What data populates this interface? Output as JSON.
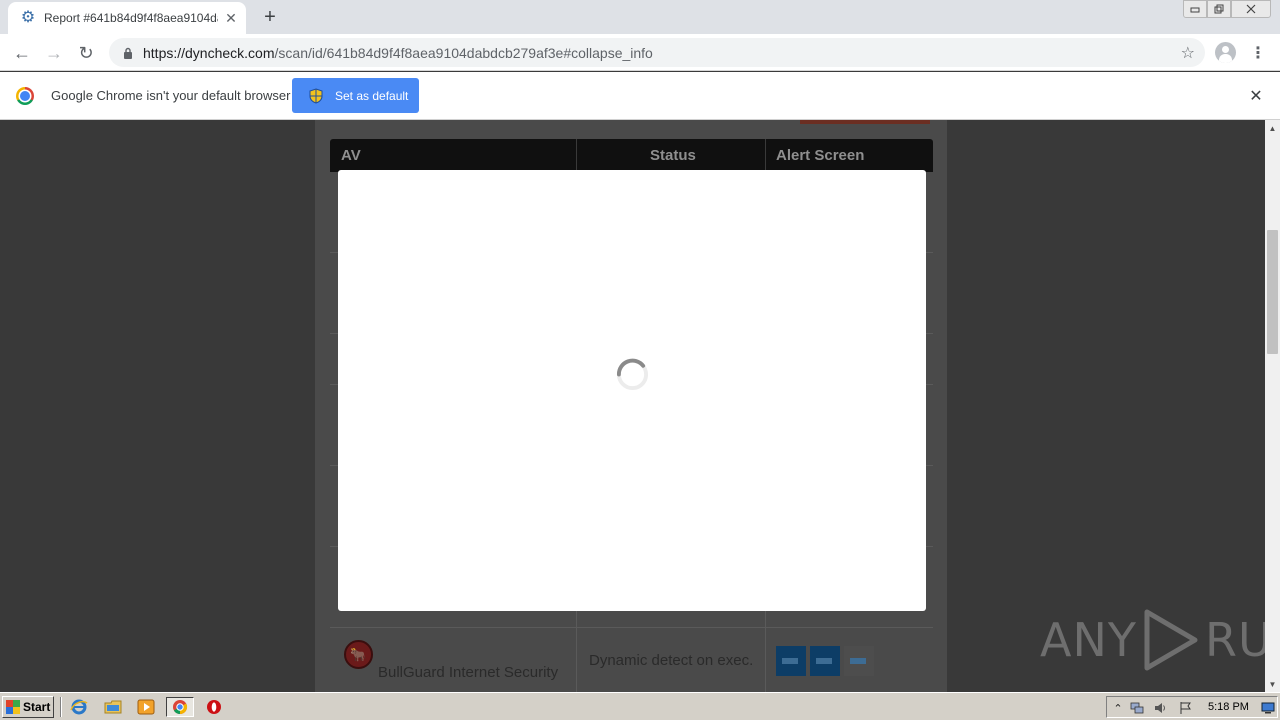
{
  "browser": {
    "tab_title": "Report #641b84d9f4f8aea9104dabdcb279af3e",
    "tab_close": "✕",
    "new_tab": "+",
    "url_domain": "https://dyncheck.com",
    "url_path": "/scan/id/641b84d9f4f8aea9104dabdcb279af3e#collapse_info",
    "window_controls": {
      "minimize": "▭",
      "restore": "⧉",
      "close": "✕"
    },
    "nav": {
      "back": "←",
      "forward": "→",
      "reload": "↻",
      "bookmark": "☆",
      "menu": "⋮"
    }
  },
  "infobar": {
    "message": "Google Chrome isn't your default browser",
    "button_label": "Set as default",
    "close": "✕"
  },
  "page": {
    "table_headers": {
      "av": "AV",
      "status": "Status",
      "alert": "Alert Screen"
    },
    "visible_row": {
      "name": "BullGuard Internet Security",
      "status": "Dynamic detect on exec."
    },
    "watermark_left": "ANY",
    "watermark_right": "RUN"
  },
  "modal": {
    "loading": true
  },
  "taskbar": {
    "start_label": "Start",
    "clock": "5:18 PM",
    "apps": [
      "internet-explorer-icon",
      "folder-icon",
      "media-player-icon",
      "chrome-icon",
      "opera-icon"
    ]
  },
  "colors": {
    "accent_blue": "#4a8af4",
    "page_overlay": "#393939",
    "table_header": "#101010",
    "taskbar": "#d4d0c8"
  }
}
